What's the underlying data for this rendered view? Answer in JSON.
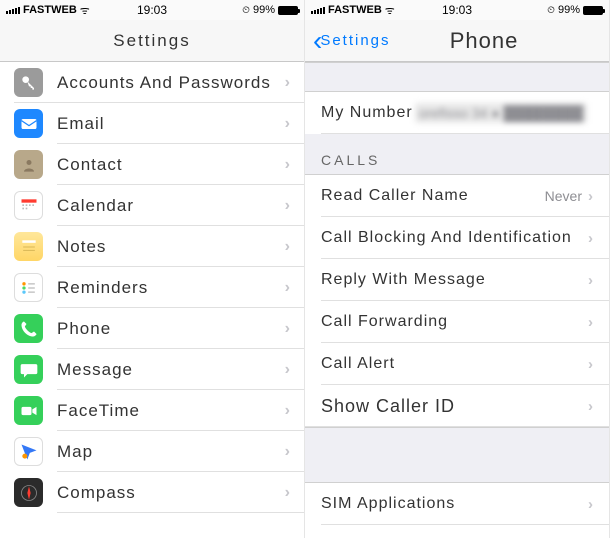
{
  "status": {
    "carrier": "FASTWEB",
    "time": "19:03",
    "battery_pct": "99%",
    "wifi_glyph": "ᯤ",
    "lock_glyph": "⏲"
  },
  "left": {
    "title": "Settings",
    "items": [
      {
        "key": "accounts",
        "label": "Accounts And Passwords"
      },
      {
        "key": "email",
        "label": "Email"
      },
      {
        "key": "contacts",
        "label": "Contact"
      },
      {
        "key": "calendar",
        "label": "Calendar"
      },
      {
        "key": "notes",
        "label": "Notes"
      },
      {
        "key": "reminders",
        "label": "Reminders"
      },
      {
        "key": "phone",
        "label": "Phone"
      },
      {
        "key": "messages",
        "label": "Message"
      },
      {
        "key": "facetime",
        "label": "FaceTime"
      },
      {
        "key": "maps",
        "label": "Map"
      },
      {
        "key": "compass",
        "label": "Compass"
      }
    ]
  },
  "right": {
    "back_label": "Settings",
    "title": "Phone",
    "my_number_label": "My Number",
    "my_number_value": "orefisso 34 ● ████████",
    "section_calls": "CALLS",
    "rows": {
      "read_caller": {
        "label": "Read Caller Name",
        "value": "Never"
      },
      "blocking": {
        "label": "Call Blocking And Identification"
      },
      "reply": {
        "label": "Reply With Message"
      },
      "forwarding": {
        "label": "Call Forwarding"
      },
      "alert": {
        "label": "Call Alert"
      },
      "show_id": {
        "label": "Show Caller ID"
      },
      "sim": {
        "label": "SIM Applications"
      }
    }
  },
  "colors": {
    "accounts": "#9b9b9b",
    "email": "#1e88ff",
    "contacts": "#b8a88a",
    "calendar": "#ffffff",
    "notes": "#ffe79a",
    "reminders": "#ffffff",
    "phone": "#35d05a",
    "messages": "#35d05a",
    "facetime": "#35d05a",
    "maps": "#ffffff",
    "compass": "#2b2b2b"
  }
}
